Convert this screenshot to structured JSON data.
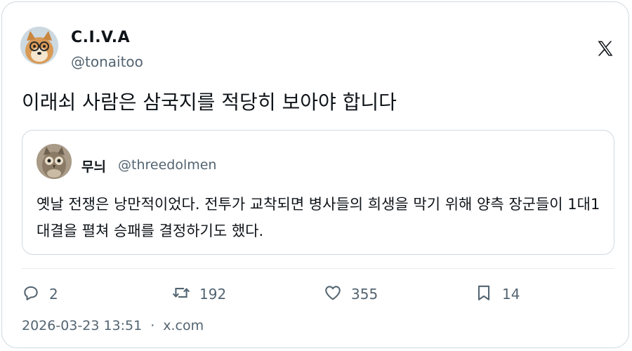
{
  "author": {
    "name": "C.I.V.A",
    "handle": "@tonaitoo"
  },
  "tweet_text": "이래쇠 사람은 삼국지를 적당히 보아야 합니다",
  "quoted": {
    "name": "무늬",
    "handle": "@threedolmen",
    "text": "옛날 전쟁은 낭만적이었다. 전투가 교착되면 병사들의 희생을 막기 위해 양측 장군들이 1대1 대결을 펼쳐 승패를 결정하기도 했다."
  },
  "actions": {
    "replies": "2",
    "retweets": "192",
    "likes": "355",
    "bookmarks": "14"
  },
  "footer": {
    "timestamp": "2026-03-23 13:51",
    "separator": "·",
    "source": "x.com"
  },
  "icons": {
    "platform": "x-logo-icon",
    "reply": "reply-icon",
    "retweet": "retweet-icon",
    "like": "heart-icon",
    "bookmark": "bookmark-icon"
  },
  "colors": {
    "text": "#0f1419",
    "secondary": "#536471",
    "border": "#cfd9de"
  }
}
